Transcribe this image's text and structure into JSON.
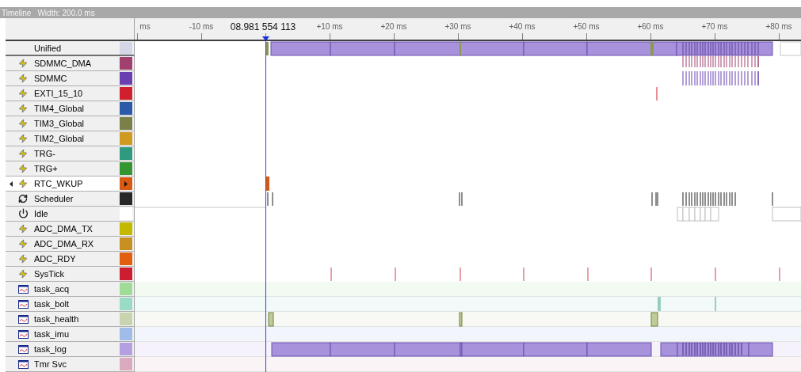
{
  "window": {
    "title": "Timeline",
    "width_label": "Width: 200.0 ms"
  },
  "ruler": {
    "ticks_before": [
      "ms",
      "-10 ms"
    ],
    "cursor_time": "08.981 554 113",
    "ticks_after": [
      "+10 ms",
      "+20 ms",
      "+30 ms",
      "+40 ms",
      "+50 ms",
      "+60 ms",
      "+70 ms",
      "+80 ms"
    ]
  },
  "rows": [
    {
      "name": "Unified",
      "kind": "unified",
      "color": "#d4d8e6",
      "selected": false
    },
    {
      "name": "SDMMC_DMA",
      "kind": "irq",
      "color": "#a0406e",
      "selected": false
    },
    {
      "name": "SDMMC",
      "kind": "irq",
      "color": "#6a3fb0",
      "selected": false
    },
    {
      "name": "EXTI_15_10",
      "kind": "irq",
      "color": "#d0202e",
      "selected": false
    },
    {
      "name": "TIM4_Global",
      "kind": "irq",
      "color": "#2a5aa8",
      "selected": false
    },
    {
      "name": "TIM3_Global",
      "kind": "irq",
      "color": "#7a8048",
      "selected": false
    },
    {
      "name": "TIM2_Global",
      "kind": "irq",
      "color": "#d09a20",
      "selected": false
    },
    {
      "name": "TRG-",
      "kind": "irq",
      "color": "#2e9a80",
      "selected": false
    },
    {
      "name": "TRG+",
      "kind": "irq",
      "color": "#349630",
      "selected": false
    },
    {
      "name": "RTC_WKUP",
      "kind": "irq",
      "color": "#d85a10",
      "selected": true
    },
    {
      "name": "Scheduler",
      "kind": "scheduler",
      "color": "#282828",
      "selected": false
    },
    {
      "name": "Idle",
      "kind": "idle",
      "color": "#ffffff",
      "selected": false
    },
    {
      "name": "ADC_DMA_TX",
      "kind": "irq",
      "color": "#c4b800",
      "selected": false
    },
    {
      "name": "ADC_DMA_RX",
      "kind": "irq",
      "color": "#c89020",
      "selected": false
    },
    {
      "name": "ADC_RDY",
      "kind": "irq",
      "color": "#e06010",
      "selected": false
    },
    {
      "name": "SysTick",
      "kind": "irq",
      "color": "#cc1e30",
      "selected": false
    },
    {
      "name": "task_acq",
      "kind": "task",
      "color": "#a0dc98",
      "selected": false
    },
    {
      "name": "task_bolt",
      "kind": "task",
      "color": "#98dcc8",
      "selected": false
    },
    {
      "name": "task_health",
      "kind": "task",
      "color": "#c8d4b0",
      "selected": false
    },
    {
      "name": "task_imu",
      "kind": "task",
      "color": "#a0bce8",
      "selected": false
    },
    {
      "name": "task_log",
      "kind": "task",
      "color": "#b4a0e0",
      "selected": false
    },
    {
      "name": "Tmr Svc",
      "kind": "task",
      "color": "#dcaac0",
      "selected": false
    }
  ]
}
